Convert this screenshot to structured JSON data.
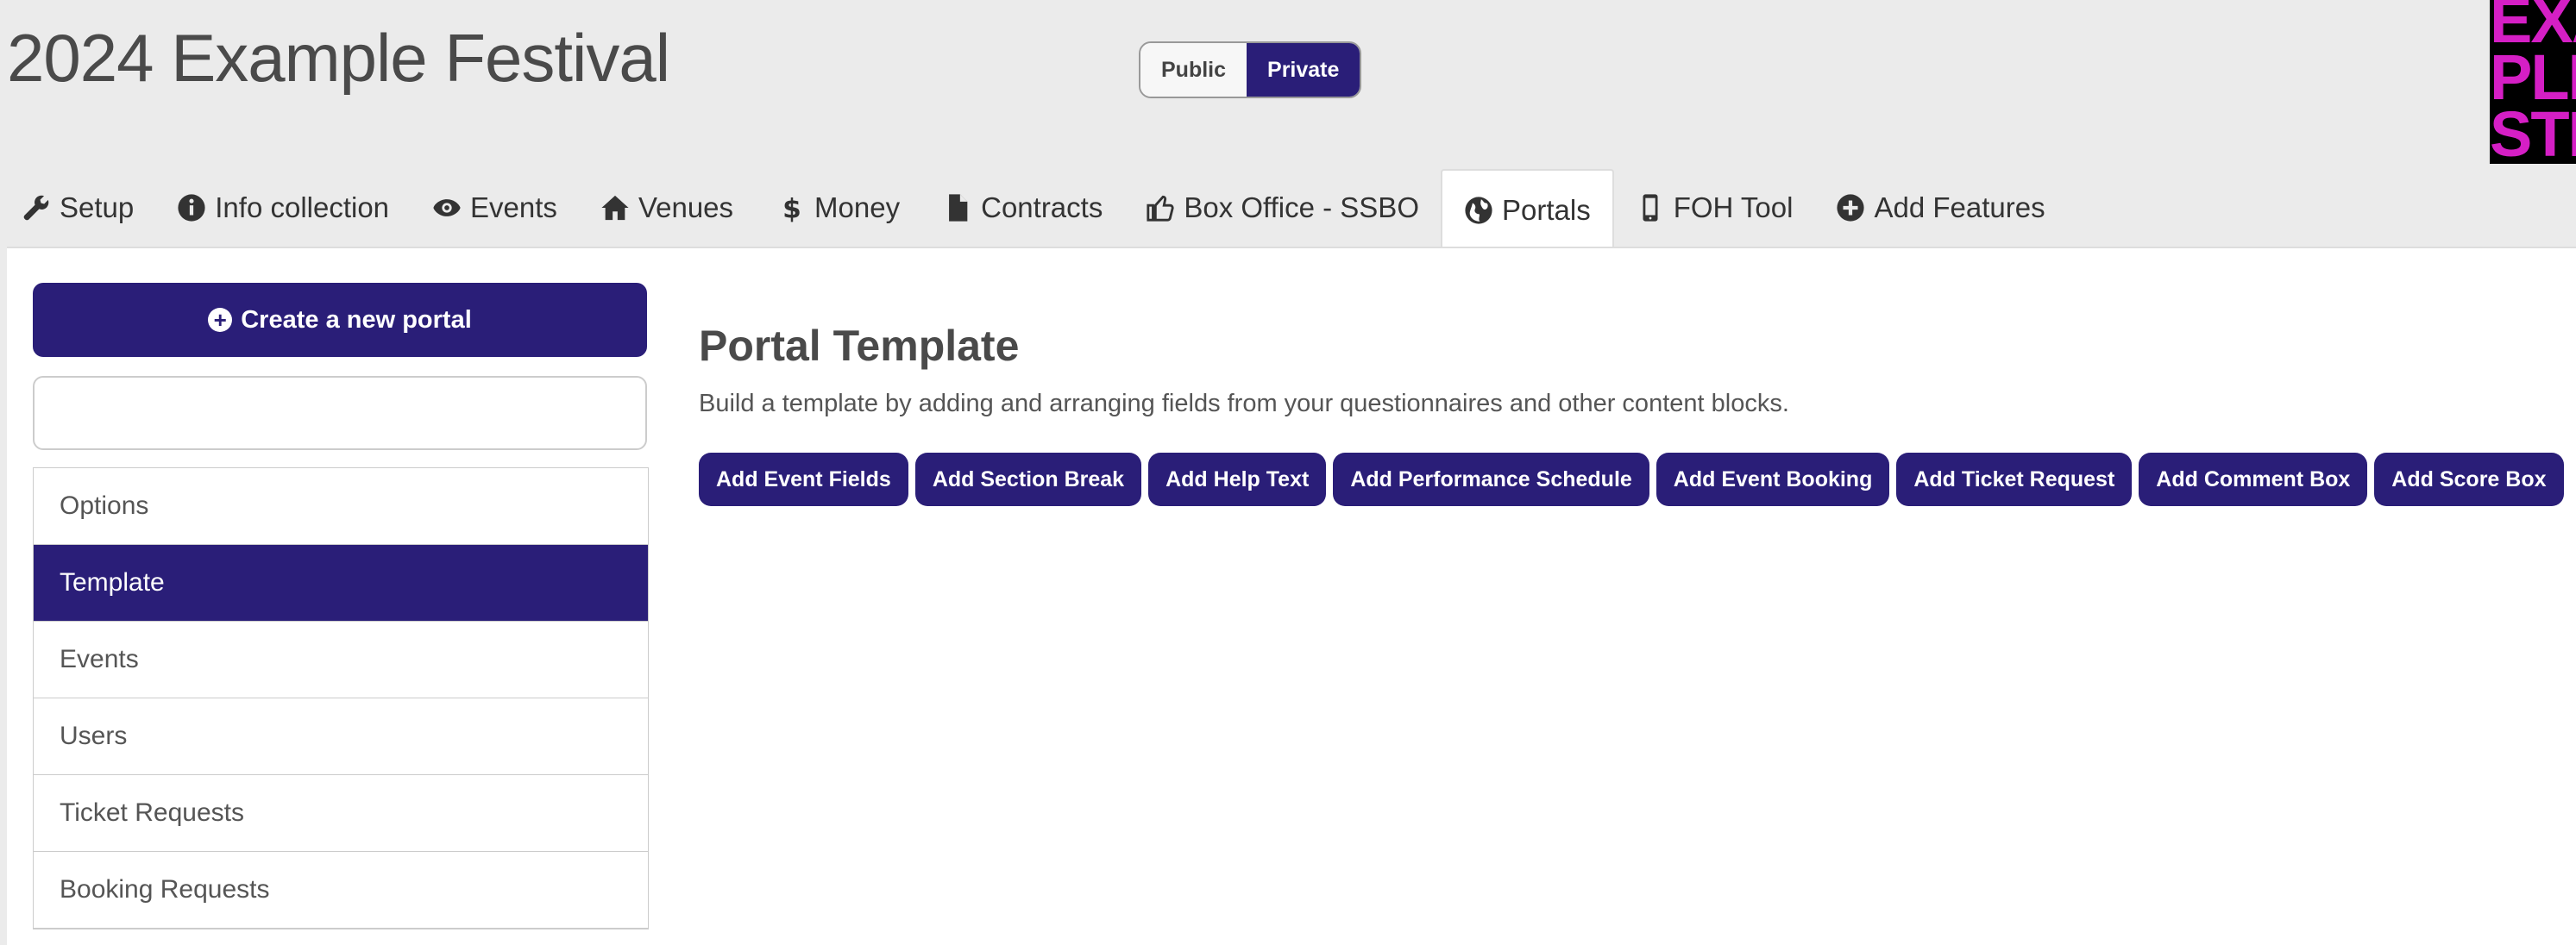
{
  "header": {
    "title": "2024 Example Festival",
    "visibility": {
      "public_label": "Public",
      "private_label": "Private",
      "selected": "Private"
    },
    "logo_lines": [
      "EXA",
      "PLE",
      "STIV"
    ]
  },
  "tabs": [
    {
      "label": "Setup",
      "icon": "wrench-icon"
    },
    {
      "label": "Info collection",
      "icon": "info-icon"
    },
    {
      "label": "Events",
      "icon": "eye-icon"
    },
    {
      "label": "Venues",
      "icon": "home-icon"
    },
    {
      "label": "Money",
      "icon": "dollar-icon"
    },
    {
      "label": "Contracts",
      "icon": "file-icon"
    },
    {
      "label": "Box Office - SSBO",
      "icon": "thumbs-up-icon"
    },
    {
      "label": "Portals",
      "icon": "globe-icon",
      "active": true
    },
    {
      "label": "FOH Tool",
      "icon": "mobile-icon"
    },
    {
      "label": "Add Features",
      "icon": "plus-circle-icon"
    }
  ],
  "sidebar": {
    "create_label": "Create a new portal",
    "search_value": "",
    "items": [
      {
        "label": "Options"
      },
      {
        "label": "Template",
        "active": true
      },
      {
        "label": "Events"
      },
      {
        "label": "Users"
      },
      {
        "label": "Ticket Requests"
      },
      {
        "label": "Booking Requests"
      }
    ]
  },
  "main": {
    "heading": "Portal Template",
    "description": "Build a template by adding and arranging fields from your questionnaires and other content blocks.",
    "buttons": [
      "Add Event Fields",
      "Add Section Break",
      "Add Help Text",
      "Add Performance Schedule",
      "Add Event Booking",
      "Add Ticket Request",
      "Add Comment Box",
      "Add Score Box"
    ]
  },
  "colors": {
    "primary": "#2a1e78",
    "logo_accent": "#d51fc5",
    "page_bg": "#ebebeb"
  }
}
